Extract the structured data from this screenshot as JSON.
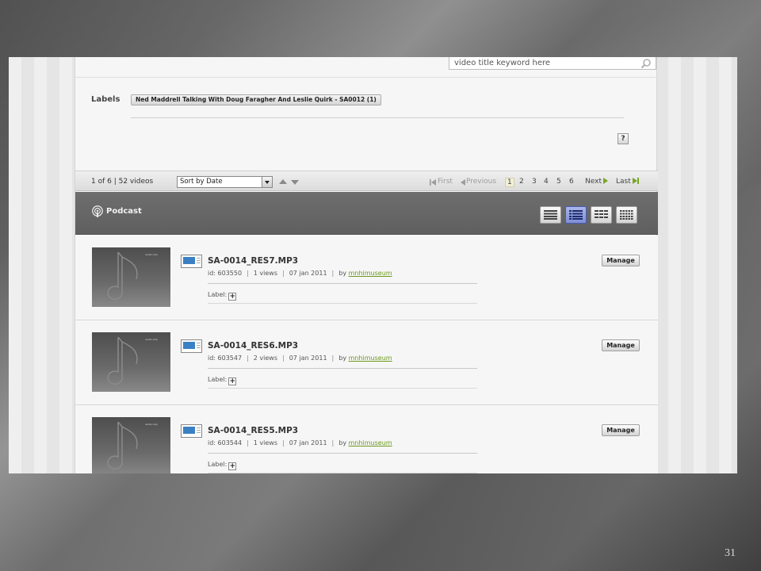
{
  "slide": {
    "page_number": "31"
  },
  "search": {
    "placeholder": "video title keyword here"
  },
  "labels": {
    "heading": "Labels",
    "tag": "Ned Maddrell Talking With Doug Faragher And Leslie Quirk - SA0012 (1)",
    "help": "?"
  },
  "pager": {
    "count": "1 of 6 | 52 videos",
    "sort_selected": "Sort by Date",
    "first": "First",
    "previous": "Previous",
    "pages": [
      "1",
      "2",
      "3",
      "4",
      "5",
      "6"
    ],
    "current_page": "1",
    "next": "Next",
    "last": "Last"
  },
  "podcast": {
    "title": "Podcast"
  },
  "thumb_caption": "audio only",
  "rows": [
    {
      "title": "SA-0014_RES7.MP3",
      "id": "id: 603550",
      "views": "1 views",
      "date": "07 jan 2011",
      "by": "by",
      "user": "mnhimuseum",
      "label": "Label:",
      "manage": "Manage"
    },
    {
      "title": "SA-0014_RES6.MP3",
      "id": "id: 603547",
      "views": "2 views",
      "date": "07 jan 2011",
      "by": "by",
      "user": "mnhimuseum",
      "label": "Label:",
      "manage": "Manage"
    },
    {
      "title": "SA-0014_RES5.MP3",
      "id": "id: 603544",
      "views": "1 views",
      "date": "07 jan 2011",
      "by": "by",
      "user": "mnhimuseum",
      "label": "Label:",
      "manage": "Manage"
    }
  ],
  "colors": {
    "accent_green": "#78a628",
    "active_view": "#7d8fd6",
    "file_icon_blue": "#3b80c4"
  }
}
